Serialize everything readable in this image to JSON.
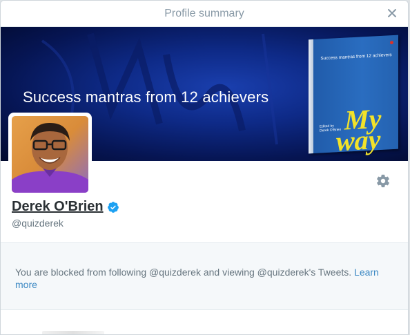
{
  "modal": {
    "title": "Profile summary",
    "close_icon": "close-icon"
  },
  "banner": {
    "headline": "Success mantras from 12 achievers",
    "book": {
      "top_text": "Success mantras from 12 achievers",
      "edited_line1": "Edited by",
      "edited_line2": "Derek O'Brien",
      "title_line1": "My",
      "title_line2": "way"
    }
  },
  "profile": {
    "name": "Derek O'Brien",
    "handle": "@quizderek",
    "verified_icon": "verified-badge-icon",
    "settings_icon": "gear-icon"
  },
  "blocked": {
    "message": "You are blocked from following @quizderek and viewing @quizderek's Tweets.",
    "link": "Learn more"
  },
  "colors": {
    "link": "#3b88c3",
    "muted": "#66757f",
    "panel_bg": "#f5f8fa",
    "verified": "#1da1f2"
  }
}
